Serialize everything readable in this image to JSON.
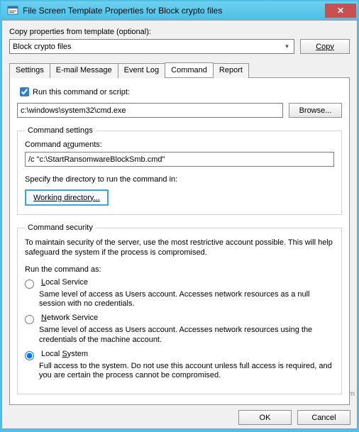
{
  "window": {
    "title": "File Screen Template Properties for Block crypto files",
    "close_label": "✕"
  },
  "template": {
    "copy_label": "Copy properties from template (optional):",
    "selected": "Block crypto files",
    "copy_button": "Copy"
  },
  "tabs": {
    "settings": "Settings",
    "email": "E-mail Message",
    "eventlog": "Event Log",
    "command": "Command",
    "report": "Report"
  },
  "command": {
    "run_label": "Run this command or script:",
    "run_value": "c:\\windows\\system32\\cmd.exe",
    "browse": "Browse...",
    "settings_legend": "Command settings",
    "args_label": "Command arguments:",
    "args_value": "/c \"c:\\StartRansomwareBlockSmb.cmd\"",
    "specify_dir": "Specify the directory to run the command in:",
    "working_dir": "Working directory...",
    "security_legend": "Command security",
    "security_note": "To maintain security of the server, use the most restrictive account possible. This will help safeguard the system if the process is compromised.",
    "run_as": "Run the command as:",
    "opt_local_service": "Local Service",
    "opt_local_service_desc": "Same level of access as Users account. Accesses network resources as a null session with no credentials.",
    "opt_network_service": "Network Service",
    "opt_network_service_desc": "Same level of access as Users account. Accesses network resources using the credentials of the machine account.",
    "opt_local_system": "Local System",
    "opt_local_system_desc": "Full access to the system. Do not use this account unless full access is required, and you are certain the process cannot be compromised."
  },
  "buttons": {
    "ok": "OK",
    "cancel": "Cancel"
  },
  "watermark": "wsxdn.com"
}
